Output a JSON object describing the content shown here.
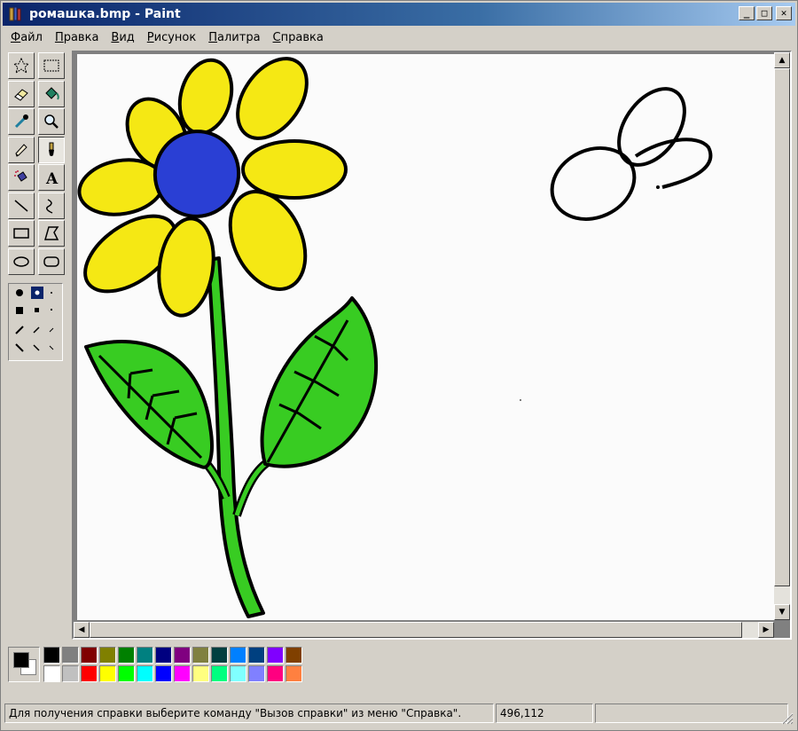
{
  "window": {
    "title": "ромашка.bmp - Paint",
    "buttons": {
      "minimize": "_",
      "maximize": "□",
      "close": "✕"
    }
  },
  "menu": [
    "Файл",
    "Правка",
    "Вид",
    "Рисунок",
    "Палитра",
    "Справка"
  ],
  "tools": [
    {
      "name": "free-select-tool",
      "icon": "star-select-icon"
    },
    {
      "name": "rect-select-tool",
      "icon": "rect-select-icon"
    },
    {
      "name": "eraser-tool",
      "icon": "eraser-icon"
    },
    {
      "name": "fill-tool",
      "icon": "paint-bucket-icon"
    },
    {
      "name": "pick-color-tool",
      "icon": "eyedropper-icon"
    },
    {
      "name": "magnifier-tool",
      "icon": "magnifier-icon"
    },
    {
      "name": "pencil-tool",
      "icon": "pencil-icon"
    },
    {
      "name": "brush-tool",
      "icon": "brush-icon"
    },
    {
      "name": "airbrush-tool",
      "icon": "airbrush-icon"
    },
    {
      "name": "text-tool",
      "icon": "text-a-icon"
    },
    {
      "name": "line-tool",
      "icon": "line-icon"
    },
    {
      "name": "curve-tool",
      "icon": "curve-icon"
    },
    {
      "name": "rectangle-tool",
      "icon": "rectangle-icon"
    },
    {
      "name": "polygon-tool",
      "icon": "polygon-icon"
    },
    {
      "name": "ellipse-tool",
      "icon": "ellipse-icon"
    },
    {
      "name": "rounded-rectangle-tool",
      "icon": "rounded-rectangle-icon"
    }
  ],
  "selected_tool": "brush-tool",
  "palette": {
    "foreground": "#000000",
    "background": "#ffffff",
    "colors": [
      "#000000",
      "#808080",
      "#800000",
      "#808000",
      "#008000",
      "#008080",
      "#000080",
      "#800080",
      "#808040",
      "#004040",
      "#0080ff",
      "#004080",
      "#8000ff",
      "#804000",
      "#ffffff",
      "#c0c0c0",
      "#ff0000",
      "#ffff00",
      "#00ff00",
      "#00ffff",
      "#0000ff",
      "#ff00ff",
      "#ffff80",
      "#00ff80",
      "#80ffff",
      "#8080ff",
      "#ff0080",
      "#ff8040"
    ]
  },
  "status": {
    "help_text": "Для получения справки выберите команду \"Вызов справки\" из меню \"Справка\".",
    "coordinates": "496,112",
    "size": ""
  },
  "drawing": {
    "petal_color": "#f5e814",
    "center_color": "#2a3fd4",
    "leaf_color": "#38cc22",
    "outline_color": "#000000"
  }
}
